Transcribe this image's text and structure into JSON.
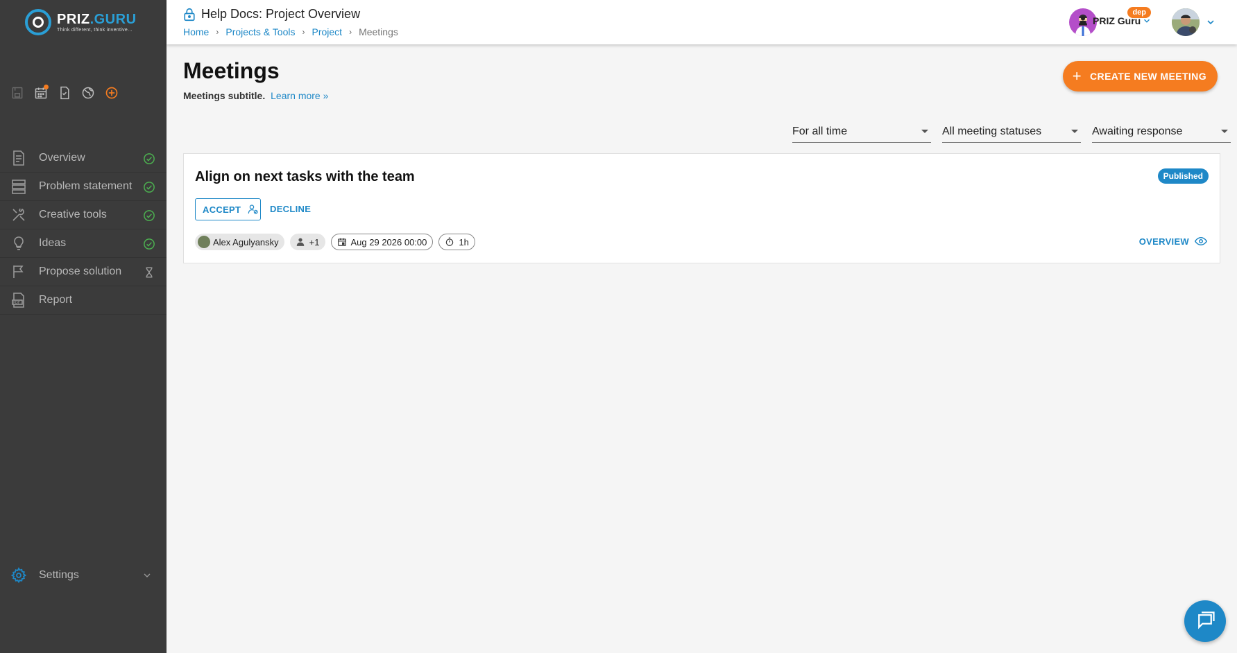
{
  "logo": {
    "name_a": "PRIZ",
    "name_dot": ".",
    "name_b": "GURU",
    "tagline": "Think different, think inventive..."
  },
  "header": {
    "title": "Help Docs: Project Overview",
    "breadcrumbs": [
      "Home",
      "Projects & Tools",
      "Project",
      "Meetings"
    ],
    "user_name": "PRIZ Guru",
    "user_badge": "dep"
  },
  "sidebar": {
    "quick_icons": [
      "save-icon",
      "calendar-icon",
      "task-icon",
      "globe-icon",
      "add-circle-icon"
    ],
    "items": [
      {
        "label": "Overview",
        "icon": "overview-icon",
        "status": "done"
      },
      {
        "label": "Problem statement",
        "icon": "layers-icon",
        "status": "done"
      },
      {
        "label": "Creative tools",
        "icon": "tools-icon",
        "status": "done"
      },
      {
        "label": "Ideas",
        "icon": "lightbulb-icon",
        "status": "done"
      },
      {
        "label": "Propose solution",
        "icon": "flag-icon",
        "status": "pending"
      },
      {
        "label": "Report",
        "icon": "pdf-icon",
        "status": ""
      }
    ],
    "settings_label": "Settings"
  },
  "page": {
    "title": "Meetings",
    "subtitle": "Meetings subtitle.",
    "learn_more": "Learn more »",
    "create_button": "CREATE NEW MEETING"
  },
  "filters": {
    "period": "For all time",
    "status": "All meeting statuses",
    "response": "Awaiting response"
  },
  "meeting": {
    "title": "Align on next tasks with the team",
    "status": "Published",
    "accept_label": "ACCEPT",
    "decline_label": "DECLINE",
    "organizer": "Alex Agulyansky",
    "attendees_extra": "+1",
    "date": "Aug 29 2026 00:00",
    "duration": "1h",
    "overview_label": "OVERVIEW"
  },
  "colors": {
    "accent": "#1e88c7",
    "orange": "#f57c20",
    "success": "#4caf50",
    "sidebar_bg": "#3b3b3b"
  }
}
